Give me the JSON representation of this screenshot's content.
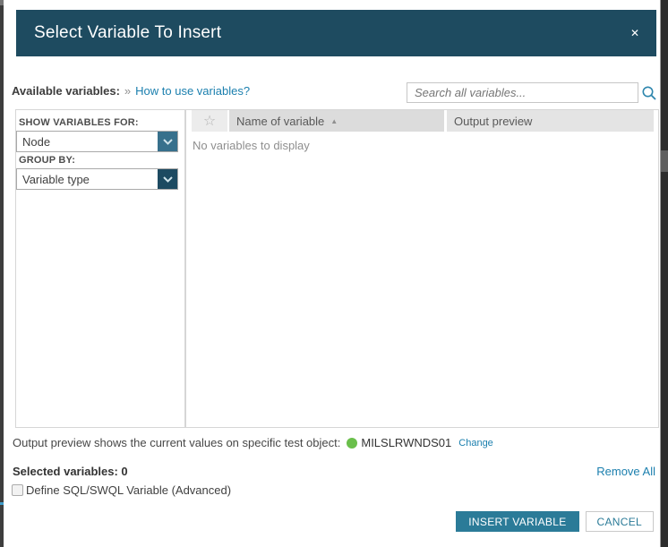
{
  "dialog": {
    "title": "Select Variable To Insert",
    "close_icon": "✕"
  },
  "toolbar": {
    "available_variables_label": "Available variables:",
    "guillemet": "»",
    "help_link": "How to use variables?",
    "search_placeholder": "Search all variables..."
  },
  "filters": {
    "show_variables_for_label": "SHOW VARIABLES FOR:",
    "show_variables_for_value": "Node",
    "group_by_label": "GROUP BY:",
    "group_by_value": "Variable type"
  },
  "table": {
    "star_icon": "☆",
    "columns": [
      {
        "label": "Name of variable",
        "sorted": "asc"
      },
      {
        "label": "Output preview",
        "sorted": null
      }
    ],
    "sort_indicator": "▲",
    "empty_message": "No variables to display"
  },
  "preview": {
    "text": "Output preview shows the current values on specific test object:",
    "object_name": "MILSLRWNDS01",
    "change_link": "Change",
    "status_color": "#6abf4b"
  },
  "selection": {
    "label": "Selected variables: 0",
    "count": "0",
    "remove_all_link": "Remove All",
    "advanced_checkbox_label": "Define SQL/SWQL Variable (Advanced)",
    "advanced_checked": false
  },
  "actions": {
    "insert_label": "INSERT VARIABLE",
    "cancel_label": "CANCEL"
  },
  "colors": {
    "header_bg": "#1e4b60",
    "accent_button": "#2b7b98",
    "link": "#1b7fae",
    "status_green": "#6abf4b"
  }
}
